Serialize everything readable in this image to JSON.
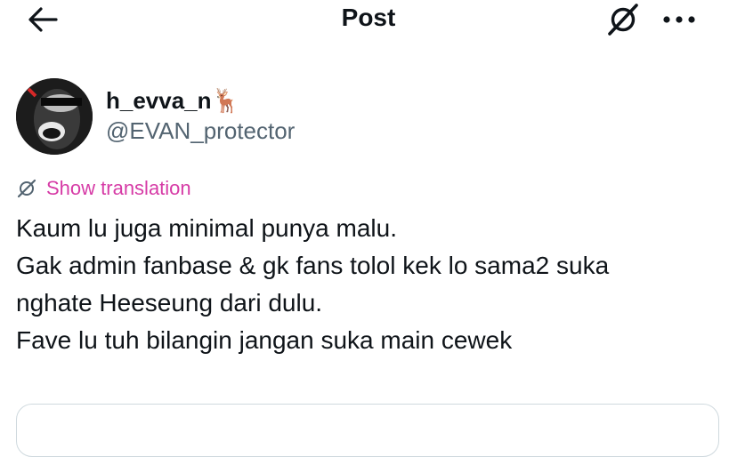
{
  "header": {
    "title": "Post",
    "back_icon": "arrow-left-icon",
    "grok_icon": "grok-icon",
    "more_icon": "more-dots-icon"
  },
  "author": {
    "display_name": "h_evva_n",
    "name_emoji": "🦌",
    "handle": "@EVAN_protector",
    "avatar_icon": "avatar"
  },
  "translation": {
    "label": "Show translation",
    "icon": "translate-icon",
    "color": "#d63ba6"
  },
  "tweet": {
    "lines": [
      "Kaum lu juga minimal punya malu.",
      "Gak admin fanbase & gk fans tolol kek lo sama2 suka",
      "nghate Heeseung dari dulu.",
      "Fave lu tuh bilangin jangan suka main cewek"
    ]
  },
  "colors": {
    "text": "#0f1419",
    "secondary": "#536471",
    "border": "#cfd9de",
    "accent": "#d63ba6"
  }
}
